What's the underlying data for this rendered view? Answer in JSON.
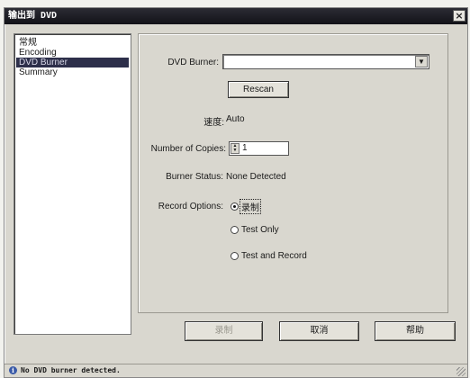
{
  "window": {
    "title": "输出到 DVD"
  },
  "sidebar": {
    "items": [
      {
        "label": "常规",
        "selected": false
      },
      {
        "label": "Encoding",
        "selected": false
      },
      {
        "label": "DVD Burner",
        "selected": true
      },
      {
        "label": "Summary",
        "selected": false
      }
    ]
  },
  "form": {
    "dvd_burner_label": "DVD Burner:",
    "dvd_burner_value": "",
    "rescan_label": "Rescan",
    "speed_label": "速度:",
    "speed_value": "Auto",
    "copies_label": "Number of Copies:",
    "copies_value": "1",
    "burner_status_label": "Burner Status:",
    "burner_status_value": "None Detected",
    "record_options_label": "Record Options:",
    "record_options": [
      {
        "label": "录制",
        "checked": true
      },
      {
        "label": "Test Only",
        "checked": false
      },
      {
        "label": "Test and Record",
        "checked": false
      }
    ]
  },
  "footer": {
    "record_button": "录制",
    "cancel_button": "取消",
    "help_button": "帮助"
  },
  "status": {
    "message": "No DVD burner detected."
  },
  "icons": {
    "close": "close-icon",
    "dropdown": "chevron-down-icon",
    "spinner": "spinner-arrows-icon",
    "info": "info-icon"
  }
}
